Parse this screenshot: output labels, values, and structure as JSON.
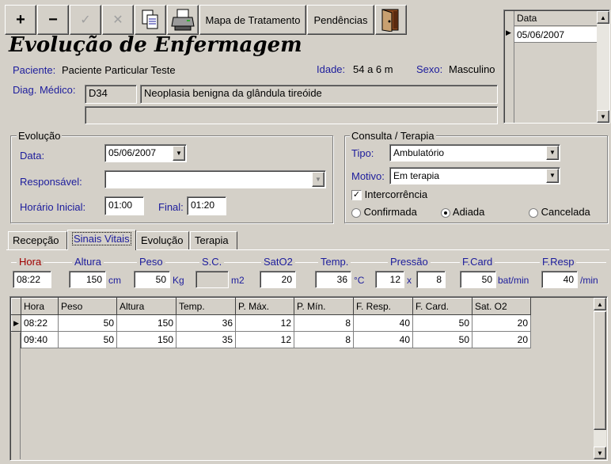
{
  "toolbar": {
    "add_glyph": "+",
    "remove_glyph": "−",
    "confirm_glyph": "✓",
    "cancel_glyph": "✕",
    "mapa_label": "Mapa de Tratamento",
    "pendencias_label": "Pendências"
  },
  "page_title": "Evolução de Enfermagem",
  "patient": {
    "paciente_label": "Paciente:",
    "paciente_value": "Paciente Particular Teste",
    "idade_label": "Idade:",
    "idade_value": "54 a 6 m",
    "sexo_label": "Sexo:",
    "sexo_value": "Masculino",
    "diag_label": "Diag. Médico:",
    "diag_code": "D34",
    "diag_desc": "Neoplasia benigna da glândula tireóide",
    "diag_extra": ""
  },
  "date_list": {
    "header": "Data",
    "items": [
      "05/06/2007"
    ]
  },
  "evolucao": {
    "title": "Evolução",
    "data_label": "Data:",
    "data_value": "05/06/2007",
    "responsavel_label": "Responsável:",
    "responsavel_value": "",
    "horario_label": "Horário Inicial:",
    "horario_value": "01:00",
    "final_label": "Final:",
    "final_value": "01:20"
  },
  "consulta": {
    "title": "Consulta / Terapia",
    "tipo_label": "Tipo:",
    "tipo_value": "Ambulatório",
    "motivo_label": "Motivo:",
    "motivo_value": "Em terapia",
    "intercorrencia_label": "Intercorrência",
    "intercorrencia_checked": true,
    "radio_options": [
      "Confirmada",
      "Adiada",
      "Cancelada"
    ],
    "radio_selected": "Adiada"
  },
  "tabs": [
    "Recepção",
    "Sinais Vitais",
    "Evolução",
    "Terapia"
  ],
  "active_tab": "Sinais Vitais",
  "vitals": {
    "headers": {
      "hora": "Hora",
      "altura": "Altura",
      "peso": "Peso",
      "sc": "S.C.",
      "sato2": "SatO2",
      "temp": "Temp.",
      "pressao": "Pressão",
      "fcard": "F.Card",
      "fresp": "F.Resp"
    },
    "values": {
      "hora": "08:22",
      "altura": "150",
      "peso": "50",
      "sc": "",
      "sato2": "20",
      "temp": "36",
      "pressao_max": "12",
      "pressao_min": "8",
      "fcard": "50",
      "fresp": "40"
    },
    "units": {
      "altura": "cm",
      "peso": "Kg",
      "sc": "m2",
      "temp": "°C",
      "pressao_sep": "x",
      "fcard": "bat/min",
      "fresp": "/min"
    }
  },
  "grid": {
    "columns": [
      "Hora",
      "Peso",
      "Altura",
      "Temp.",
      "P. Máx.",
      "P. Mín.",
      "F. Resp.",
      "F. Card.",
      "Sat. O2"
    ],
    "rows": [
      [
        "08:22",
        "50",
        "150",
        "36",
        "12",
        "8",
        "40",
        "50",
        "20"
      ],
      [
        "09:40",
        "50",
        "150",
        "35",
        "12",
        "8",
        "40",
        "50",
        "20"
      ]
    ],
    "current_row": 0
  }
}
